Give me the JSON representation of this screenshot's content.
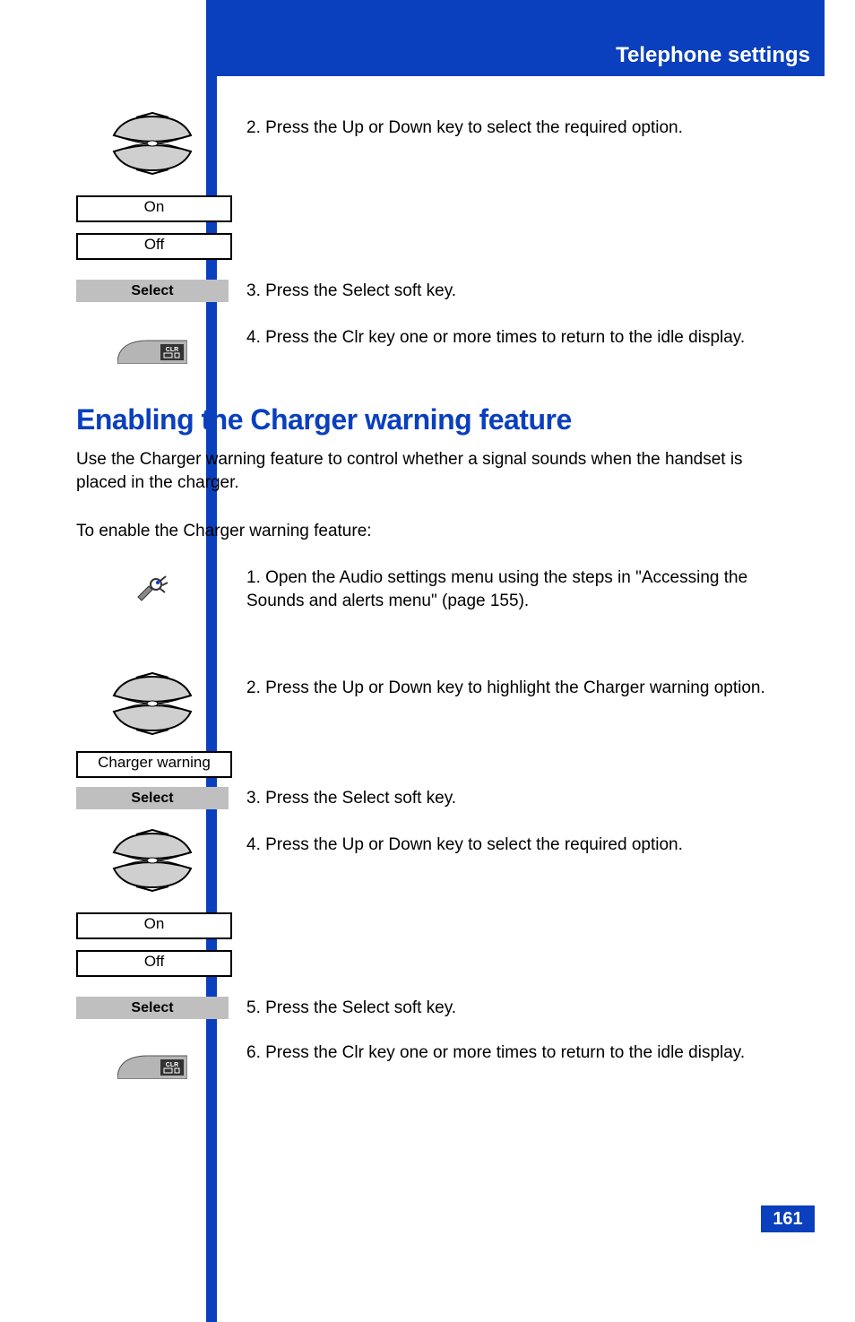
{
  "header": {
    "title": "Telephone settings"
  },
  "page_number": "161",
  "section_heading": "Enabling the Charger warning feature",
  "section_para": "Use the Charger warning feature to control whether a signal sounds when the handset is placed in the charger.",
  "step_intro": "To enable the Charger warning feature:",
  "step1": "1.   Open the Audio settings menu using the steps in \"Accessing the Sounds and alerts menu\" (page 155).",
  "block_a": {
    "step": "2.   Press the Up or Down key to select the required option.",
    "options": [
      "On",
      "Off"
    ],
    "select": "Select",
    "step_sel": "3.   Press the Select soft key.",
    "clr": "CLR",
    "step_clr": "4.   Press the Clr key one or more times to return to the idle display."
  },
  "block_b1": {
    "step_nav": "2.   Press the Up or Down key to highlight the Charger warning option.",
    "menu_item": "Charger warning",
    "select": "Select",
    "step_sel": "3.   Press the Select soft key."
  },
  "block_b2": {
    "step": "4.   Press the Up or Down key to select the required option.",
    "options": [
      "On",
      "Off"
    ],
    "select": "Select",
    "step_sel": "5.   Press the Select soft key.",
    "clr": "CLR",
    "step_clr": "6.   Press the Clr key one or more times to return to the idle display."
  }
}
